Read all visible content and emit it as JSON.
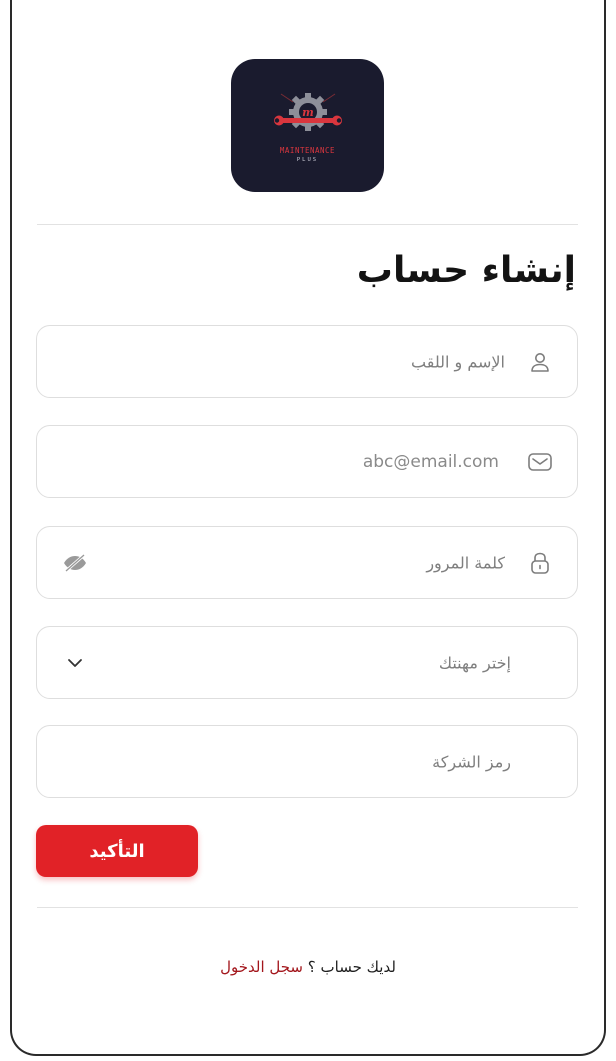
{
  "app": {
    "logo_text": "MAINTENANCE",
    "logo_subtext": "PLUS"
  },
  "page": {
    "title": "إنشاء حساب"
  },
  "form": {
    "fullname": {
      "placeholder": "الإسم و اللقب",
      "icon": "user-icon"
    },
    "email": {
      "placeholder": "abc@email.com",
      "icon": "mail-icon"
    },
    "password": {
      "placeholder": "كلمة المرور",
      "icon": "lock-icon",
      "toggle_icon": "eye-slash-icon"
    },
    "profession": {
      "placeholder": "إختر مهنتك",
      "icon": "chevron-down-icon"
    },
    "company_code": {
      "placeholder": "رمز الشركة"
    },
    "submit_label": "التأكيد"
  },
  "footer": {
    "prompt": "لديك حساب ؟",
    "signin_link": "سجل الدخول"
  },
  "colors": {
    "accent": "#e12227",
    "link": "#a3161c",
    "logo_bg": "#1a1b2e"
  }
}
